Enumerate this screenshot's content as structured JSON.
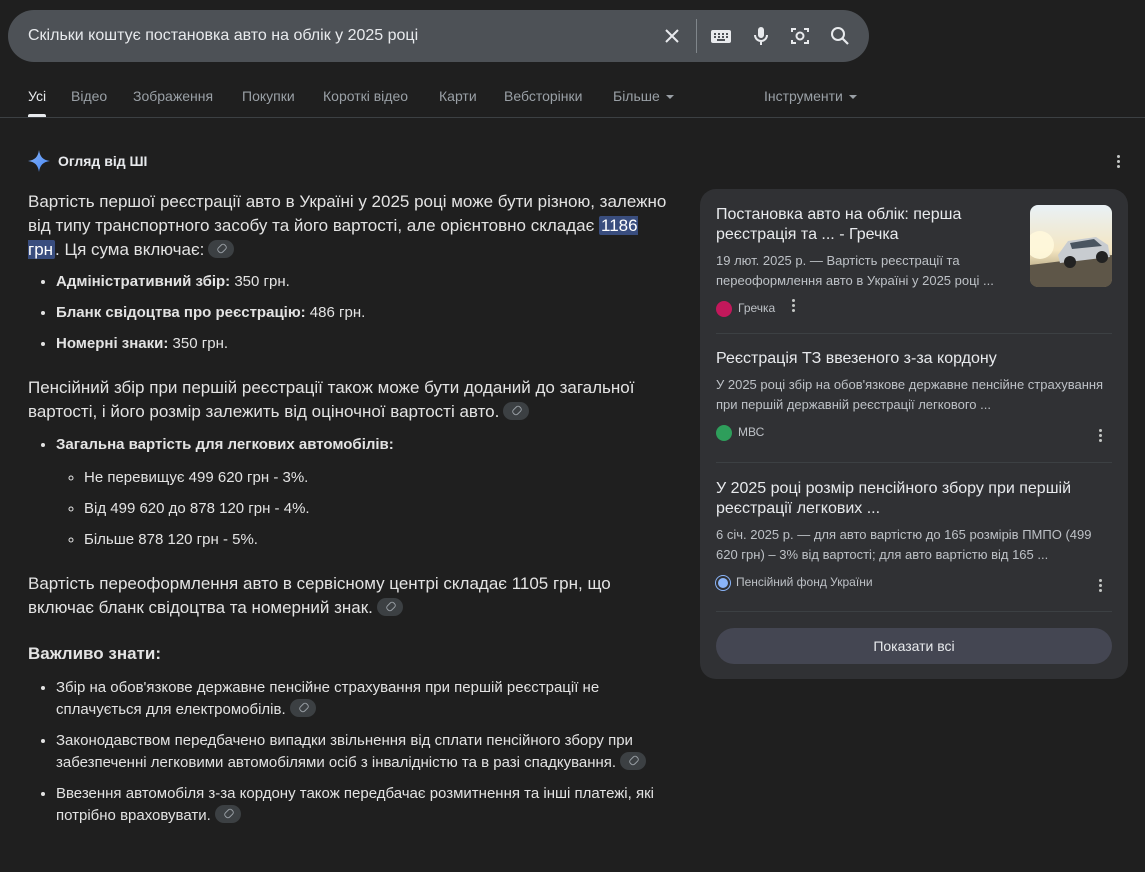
{
  "search": {
    "query": "Скільки коштує постановка авто на облік у 2025 році"
  },
  "tabs": [
    {
      "label": "Усі"
    },
    {
      "label": "Відео"
    },
    {
      "label": "Зображення"
    },
    {
      "label": "Покупки"
    },
    {
      "label": "Короткі відео"
    },
    {
      "label": "Карти"
    },
    {
      "label": "Вебсторінки"
    },
    {
      "label": "Більше"
    },
    {
      "label": "Інструменти"
    }
  ],
  "ai": {
    "header": "Огляд від ШІ",
    "p1_a": "Вартість першої реєстрації авто в Україні у 2025 році може бути різною, залежно від типу транспортного засобу та його вартості, але орієнтовно складає ",
    "p1_hl": "1186 грн",
    "p1_b": ". Ця сума включає:",
    "fees": [
      {
        "label": "Адміністративний збір:",
        "value": " 350 грн."
      },
      {
        "label": "Бланк свідоцтва про реєстрацію:",
        "value": " 486 грн."
      },
      {
        "label": "Номерні знаки:",
        "value": " 350 грн."
      }
    ],
    "p2": "Пенсійний збір при першій реєстрації також може бути доданий до загальної вартості, і його розмір залежить від оціночної вартості авто.",
    "total_label": "Загальна вартість для легкових автомобілів:",
    "brackets": [
      "Не перевищує 499 620 грн - 3%.",
      "Від 499 620 до 878 120 грн - 4%.",
      "Більше 878 120 грн - 5%."
    ],
    "p3": "Вартість переоформлення авто в сервісному центрі складає 1105 грн, що включає бланк свідоцтва та номерний знак.",
    "important": "Важливо знати:",
    "notes": [
      "Збір на обов'язкове державне пенсійне страхування при першій реєстрації не сплачується для електромобілів.",
      "Законодавством передбачено випадки звільнення від сплати пенсійного збору при забезпеченні легковими автомобілями осіб з інвалідністю та в разі спадкування.",
      "Ввезення автомобіля з-за кордону також передбачає розмитнення та інші платежі, які потрібно враховувати."
    ]
  },
  "sources": [
    {
      "title": "Постановка авто на облік: перша реєстрація та ... - Гречка",
      "desc": "19 лют. 2025 р. — Вартість реєстрації та переоформлення авто в Україні у 2025 році ...",
      "site": "Гречка"
    },
    {
      "title": "Реєстрація ТЗ ввезеного з-за кордону",
      "desc": "У 2025 році збір на обов'язкове державне пенсійне страхування при першій державній реєстрації легкового ...",
      "site": "МВС"
    },
    {
      "title": "У 2025 році розмір пенсійного збору при першій реєстрації легкових ...",
      "desc": "6 січ. 2025 р. — для авто вартістю до 165 розмірів ПМПО (499 620 грн) – 3% від вартості; для авто вартістю від 165 ...",
      "site": "Пенсійний фонд України"
    }
  ],
  "show_all": "Показати всі",
  "colors": {
    "background": "#1f1f1f",
    "card": "#303134",
    "highlight": "#394d7e",
    "accent": "#8ab4f8"
  }
}
